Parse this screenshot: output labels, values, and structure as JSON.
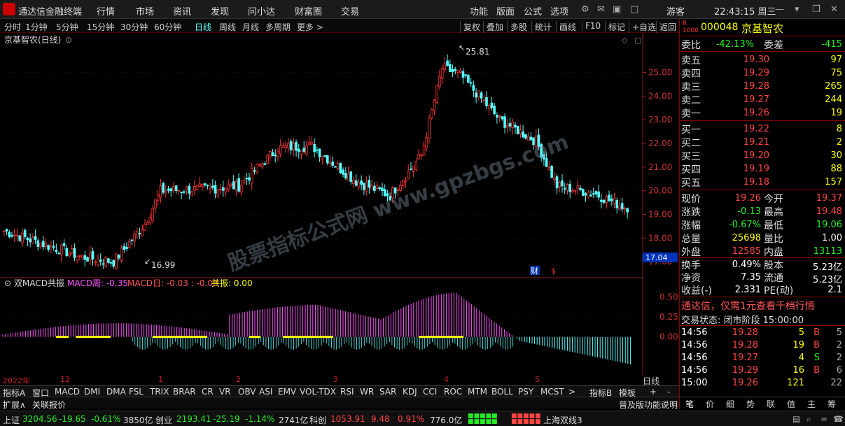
{
  "title_bar": {
    "app_name": "通达信金融终端",
    "menus": [
      "行情",
      "市场",
      "资讯",
      "发现",
      "问小达",
      "财富圈",
      "交易"
    ],
    "right_menus": [
      "功能",
      "版面",
      "公式",
      "选项"
    ],
    "user": "游客",
    "clock": "22:43:15 周三"
  },
  "period_bar": {
    "periods": [
      "分时",
      "1分钟",
      "5分钟",
      "15分钟",
      "30分钟",
      "60分钟",
      "日线",
      "周线",
      "月线",
      "多周期",
      "更多 >"
    ],
    "active": "日线",
    "right_buttons": [
      "复权",
      "叠加",
      "多股",
      "统计",
      "画线",
      "F10",
      "标记",
      "+自选",
      "返回"
    ]
  },
  "chart": {
    "stock_title": "京基智农(日线)",
    "high_label": "25.81",
    "low_label": "16.99",
    "current_price_tag": "17.04",
    "badge_cai": "财",
    "badge_s": "$",
    "indicator_title": "双MACD共振",
    "indicator_week": "MACD周: -0.35",
    "indicator_day": "MACD日: -0.03 : -0.03",
    "indicator_resonance": "共振: 0.00",
    "watermark": "股票指标公式网 www.gpzbgs.com",
    "price_axis": [
      "25.00",
      "24.00",
      "23.00",
      "22.00",
      "21.00",
      "20.00",
      "19.00",
      "18.00",
      "17.00"
    ],
    "macd_axis": [
      "0.50",
      "0.25",
      "0.00"
    ],
    "date_labels": [
      "2022年",
      "12",
      "1",
      "2",
      "3",
      "4",
      "5"
    ],
    "right_tag": "日线",
    "price_lim": [
      16.5,
      26.2
    ],
    "macd_lim": [
      -0.45,
      0.6
    ]
  },
  "chart_data": {
    "type": "candlestick",
    "series_price_anchor": [
      {
        "i": 0,
        "v": 18.3
      },
      {
        "i": 30,
        "v": 17.2
      },
      {
        "i": 42,
        "v": 17.0
      },
      {
        "i": 54,
        "v": 18.6
      },
      {
        "i": 60,
        "v": 20.0
      },
      {
        "i": 80,
        "v": 20.1
      },
      {
        "i": 90,
        "v": 20.2
      },
      {
        "i": 105,
        "v": 21.8
      },
      {
        "i": 118,
        "v": 21.9
      },
      {
        "i": 135,
        "v": 20.4
      },
      {
        "i": 148,
        "v": 19.8
      },
      {
        "i": 160,
        "v": 21.5
      },
      {
        "i": 168,
        "v": 25.2
      },
      {
        "i": 175,
        "v": 24.9
      },
      {
        "i": 190,
        "v": 23.0
      },
      {
        "i": 204,
        "v": 22.1
      },
      {
        "i": 212,
        "v": 20.2
      },
      {
        "i": 226,
        "v": 19.9
      },
      {
        "i": 238,
        "v": 19.3
      }
    ]
  },
  "quote": {
    "code": "000048",
    "name": "京基智农",
    "rz": "R",
    "rz2": "1000",
    "weibi_label": "委比",
    "weibi": "-42.13%",
    "weicha_label": "委差",
    "weicha": "-415",
    "asks": [
      {
        "label": "卖五",
        "price": "19.30",
        "vol": "97"
      },
      {
        "label": "卖四",
        "price": "19.29",
        "vol": "75"
      },
      {
        "label": "卖三",
        "price": "19.28",
        "vol": "265"
      },
      {
        "label": "卖二",
        "price": "19.27",
        "vol": "244"
      },
      {
        "label": "卖一",
        "price": "19.26",
        "vol": "19"
      }
    ],
    "bids": [
      {
        "label": "买一",
        "price": "19.22",
        "vol": "8"
      },
      {
        "label": "买二",
        "price": "19.21",
        "vol": "2"
      },
      {
        "label": "买三",
        "price": "19.20",
        "vol": "30"
      },
      {
        "label": "买四",
        "price": "19.19",
        "vol": "88"
      },
      {
        "label": "买五",
        "price": "19.18",
        "vol": "157"
      }
    ],
    "stats": [
      {
        "l1": "现价",
        "v1": "19.26",
        "c1": "up",
        "l2": "今开",
        "v2": "19.37",
        "c2": "up"
      },
      {
        "l1": "涨跌",
        "v1": "-0.13",
        "c1": "dn",
        "l2": "最高",
        "v2": "19.48",
        "c2": "up"
      },
      {
        "l1": "涨幅",
        "v1": "-0.67%",
        "c1": "dn",
        "l2": "最低",
        "v2": "19.06",
        "c2": "dn"
      },
      {
        "l1": "总量",
        "v1": "25698",
        "c1": "yl",
        "l2": "量比",
        "v2": "1.00",
        "c2": "wh"
      },
      {
        "l1": "外盘",
        "v1": "12585",
        "c1": "up",
        "l2": "内盘",
        "v2": "13113",
        "c2": "dn"
      }
    ],
    "stats2": [
      {
        "l1": "换手",
        "v1": "0.49%",
        "l2": "股本",
        "v2": "5.23亿"
      },
      {
        "l1": "净资",
        "v1": "7.35",
        "l2": "流通",
        "v2": "5.23亿"
      },
      {
        "l1": "收益(-)",
        "v1": "2.331",
        "l2": "PE(动)",
        "v2": "2.1"
      }
    ],
    "promo": "通达信，仅需1元查看千档行情",
    "trade_state": "交易状态: 闭市阶段 15:00:00",
    "ticks": [
      {
        "t": "14:56",
        "p": "19.28",
        "v": "5",
        "bs": "B",
        "n": "5"
      },
      {
        "t": "14:56",
        "p": "19.28",
        "v": "19",
        "bs": "B",
        "n": "2"
      },
      {
        "t": "14:56",
        "p": "19.27",
        "v": "4",
        "bs": "S",
        "n": "2"
      },
      {
        "t": "14:56",
        "p": "19.29",
        "v": "16",
        "bs": "B",
        "n": "6"
      },
      {
        "t": "15:00",
        "p": "19.26",
        "v": "121",
        "bs": "",
        "n": "22"
      }
    ],
    "bottom_tabs": [
      "笔",
      "价",
      "细",
      "势",
      "联",
      "值",
      "主",
      "筹"
    ]
  },
  "indicator_tabs": [
    "指标A",
    "窗口",
    "MACD",
    "DMI",
    "DMA",
    "FSL",
    "TRIX",
    "BRAR",
    "CR",
    "VR",
    "OBV",
    "ASI",
    "EMV",
    "VOL-TDX",
    "RSI",
    "WR",
    "SAR",
    "KDJ",
    "CCI",
    "ROC",
    "MTM",
    "BOLL",
    "PSY",
    "MCST",
    ">"
  ],
  "indicator_right": [
    "指标B",
    "模板",
    "+",
    "-"
  ],
  "ext_bar": {
    "left": [
      "扩展∧",
      "关联报价"
    ],
    "right": "普及版功能说明"
  },
  "status_bar": {
    "items": [
      {
        "name": "上证",
        "p": "3204.56",
        "c": "-19.65",
        "pct": "-0.61%",
        "amt": "3850亿"
      },
      {
        "name": "创业",
        "p": "2193.41",
        "c": "-25.19",
        "pct": "-1.14%",
        "amt": "2741亿"
      },
      {
        "name": "科创",
        "p": "1053.91",
        "c": "9.48",
        "pct": "0.91%",
        "amt": "776.0亿"
      }
    ],
    "ticker": "上海双线3"
  },
  "colors": {
    "up": "#ff4444",
    "down": "#54ffff",
    "axis_red": "#cc2222",
    "magenta": "#ff55ff",
    "yellow": "#ffff00"
  }
}
